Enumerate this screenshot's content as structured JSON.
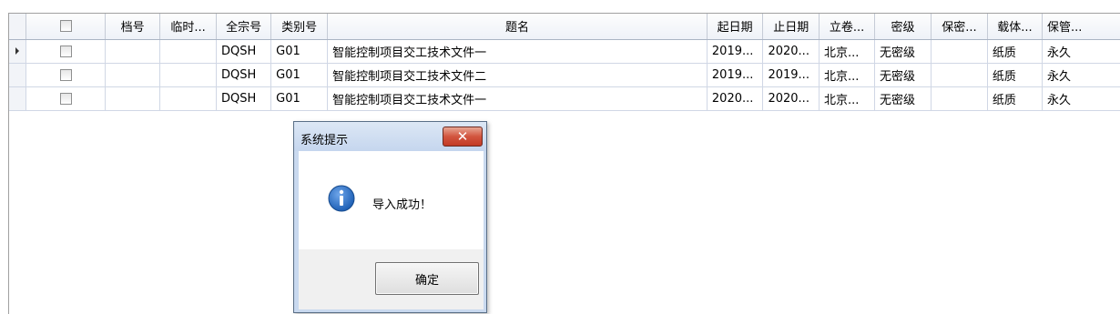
{
  "grid": {
    "columns": [
      "",
      "",
      "档号",
      "临时...",
      "全宗号",
      "类别号",
      "题名",
      "起日期",
      "止日期",
      "立卷...",
      "密级",
      "保密...",
      "载体...",
      "保管..."
    ],
    "rows": [
      [
        "",
        "",
        "",
        "",
        "DQSH",
        "G01",
        "智能控制项目交工技术文件一",
        "2019...",
        "2020...",
        "北京...",
        "无密级",
        "",
        "纸质",
        "永久"
      ],
      [
        "",
        "",
        "",
        "",
        "DQSH",
        "G01",
        "智能控制项目交工技术文件二",
        "2019...",
        "2019...",
        "北京...",
        "无密级",
        "",
        "纸质",
        "永久"
      ],
      [
        "",
        "",
        "",
        "",
        "DQSH",
        "G01",
        "智能控制项目交工技术文件一",
        "2020...",
        "2020...",
        "北京...",
        "无密级",
        "",
        "纸质",
        "永久"
      ]
    ],
    "current_row_indicator": "arrow-right-icon"
  },
  "dialog": {
    "title": "系统提示",
    "message": "导入成功！",
    "ok_label": "确定",
    "icon": "info-icon",
    "close_icon": "close-icon"
  },
  "colors": {
    "grid_line": "#d0d7e5",
    "dialog_frame": "#c9d9ef",
    "close_button": "#c23a25",
    "info_icon": "#1d5fb5"
  }
}
